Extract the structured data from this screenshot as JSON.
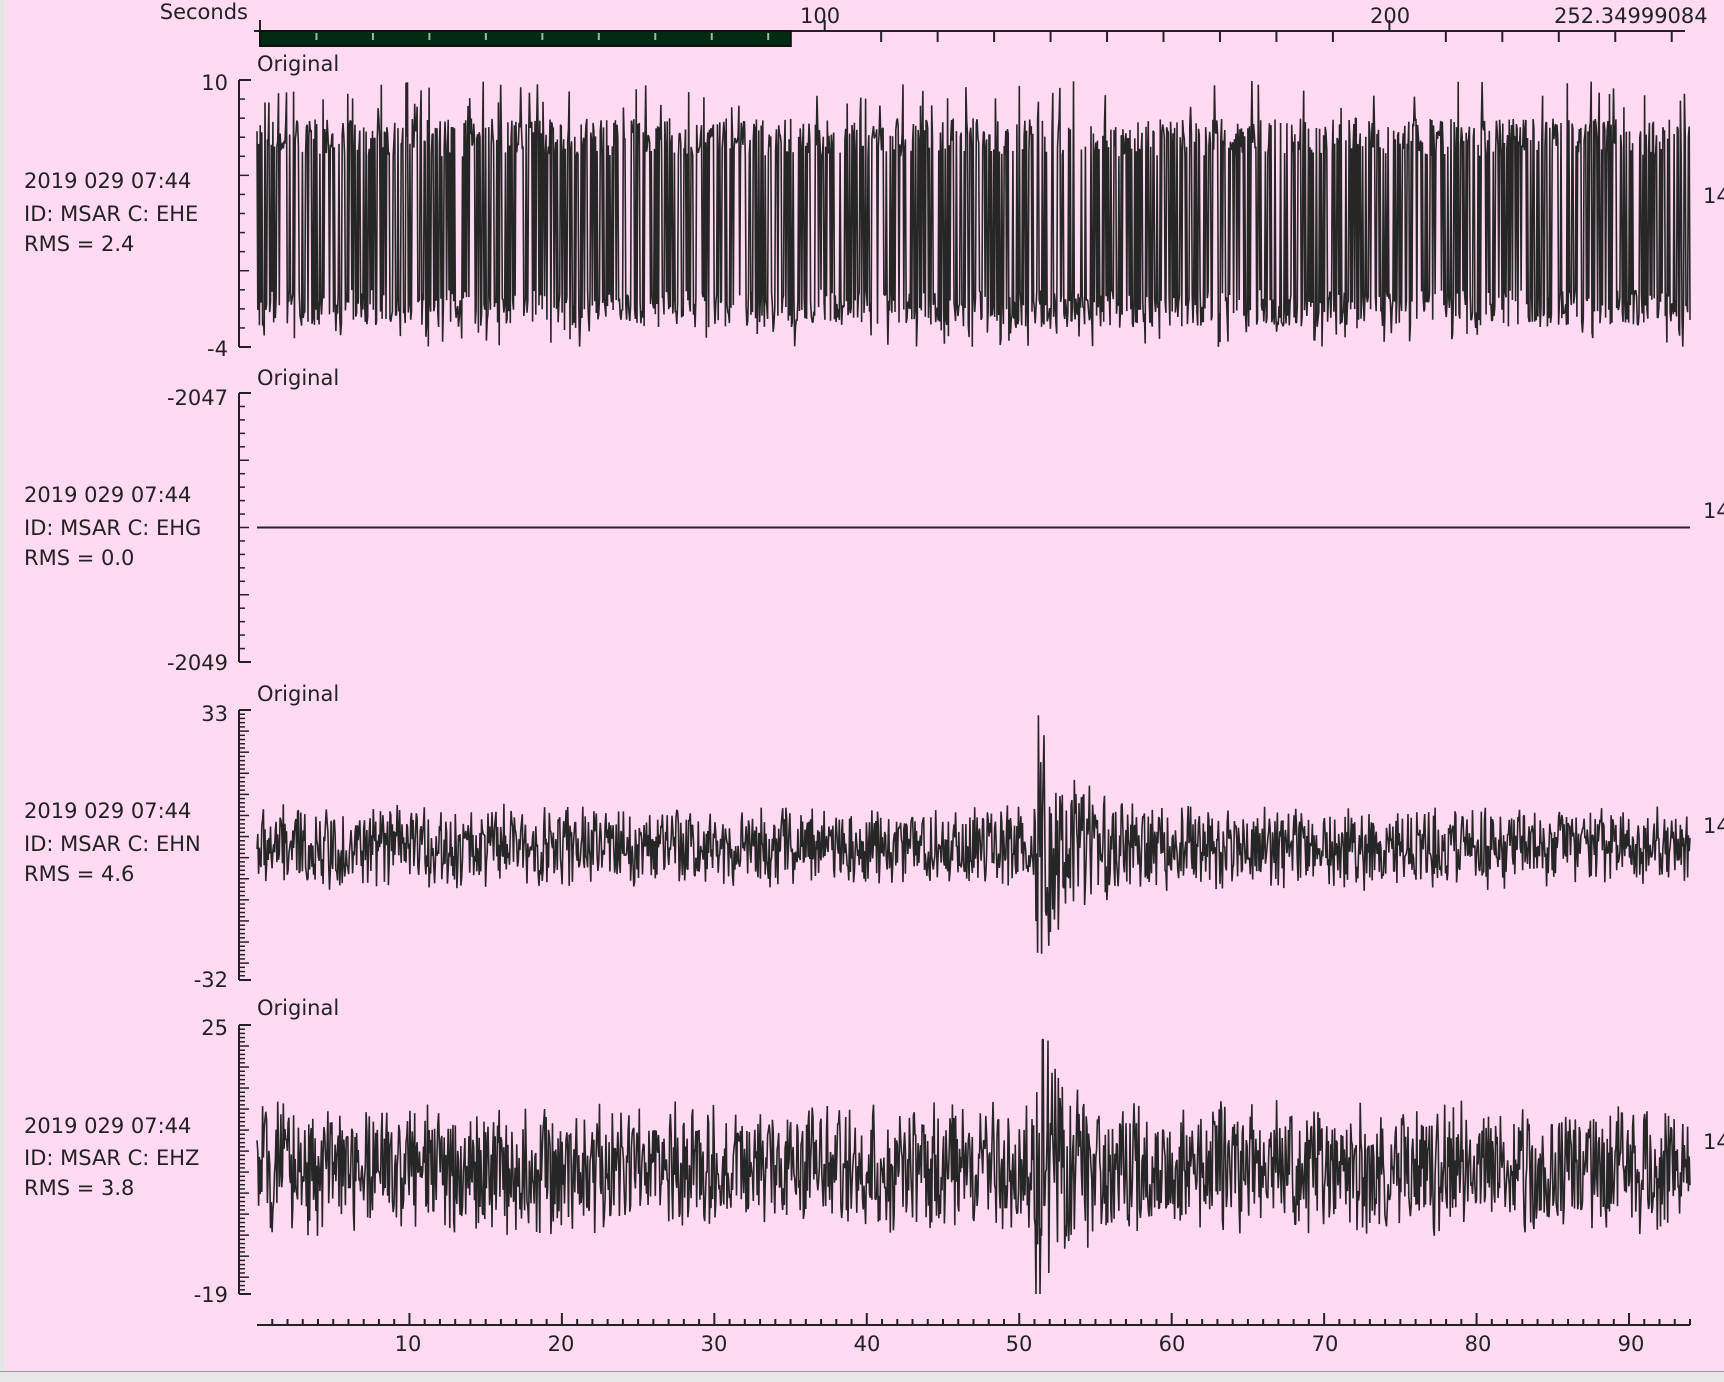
{
  "scrollbar": {
    "label": "Seconds",
    "tick_labels": [
      "100",
      "200",
      "252.34999084"
    ],
    "range": [
      0,
      252.34999084
    ],
    "thumb": [
      0,
      94
    ]
  },
  "x_axis": {
    "range": [
      0,
      94
    ],
    "tick_labels": [
      "10",
      "20",
      "30",
      "40",
      "50",
      "60",
      "70",
      "80",
      "90"
    ]
  },
  "channels": [
    {
      "panel_title": "Original",
      "date": "2019 029 07:44",
      "id_line": "ID: MSAR C: EHE",
      "rms_line": "RMS = 2.4",
      "ymax_label": "10",
      "ymin_label": "-4",
      "right_label": "14",
      "ylim": [
        -4,
        10
      ],
      "noise": [
        -3,
        8
      ],
      "kind": "clipped"
    },
    {
      "panel_title": "Original",
      "date": "2019 029 07:44",
      "id_line": "ID: MSAR C: EHG",
      "rms_line": "RMS = 0.0",
      "ymax_label": "-2047",
      "ymin_label": "-2049",
      "right_label": "14",
      "ylim": [
        -2049,
        -2047
      ],
      "noise": [
        -2048,
        -2048
      ],
      "kind": "flat"
    },
    {
      "panel_title": "Original",
      "date": "2019 029 07:44",
      "id_line": "ID: MSAR C: EHN",
      "rms_line": "RMS = 4.6",
      "ymax_label": "33",
      "ymin_label": "-32",
      "right_label": "14",
      "ylim": [
        -32,
        33
      ],
      "noise": [
        -10,
        10
      ],
      "kind": "event"
    },
    {
      "panel_title": "Original",
      "date": "2019 029 07:44",
      "id_line": "ID: MSAR C: EHZ",
      "rms_line": "RMS = 3.8",
      "ymax_label": "25",
      "ymin_label": "-19",
      "right_label": "14",
      "ylim": [
        -19,
        25
      ],
      "noise": [
        -9,
        12
      ],
      "kind": "event"
    }
  ],
  "colors": {
    "background": "#ffdaf2",
    "trace": "#262626",
    "thumb": "#002a12"
  }
}
